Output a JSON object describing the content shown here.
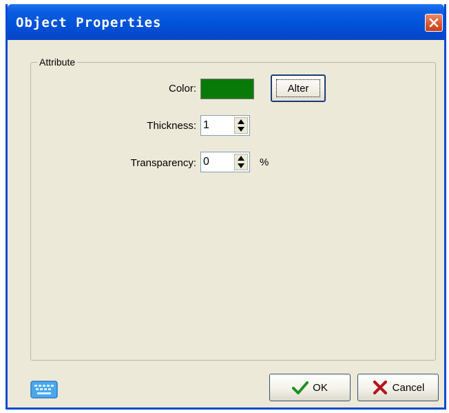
{
  "window": {
    "title": "Object Properties"
  },
  "attribute_group": {
    "label": "Attribute",
    "color_label": "Color:",
    "color_value": "#087a08",
    "alter_button": "Alter",
    "thickness_label": "Thickness:",
    "thickness_value": "1",
    "transparency_label": "Transparency:",
    "transparency_value": "0",
    "transparency_unit": "%"
  },
  "footer": {
    "ok_label": "OK",
    "cancel_label": "Cancel"
  },
  "icons": {
    "close": "close-icon",
    "keyboard": "keyboard-icon",
    "ok": "checkmark-icon",
    "cancel": "x-mark-icon"
  },
  "colors": {
    "titlebar": "#0053d9",
    "dialog_bg": "#ece9d8",
    "swatch": "#087a08"
  }
}
